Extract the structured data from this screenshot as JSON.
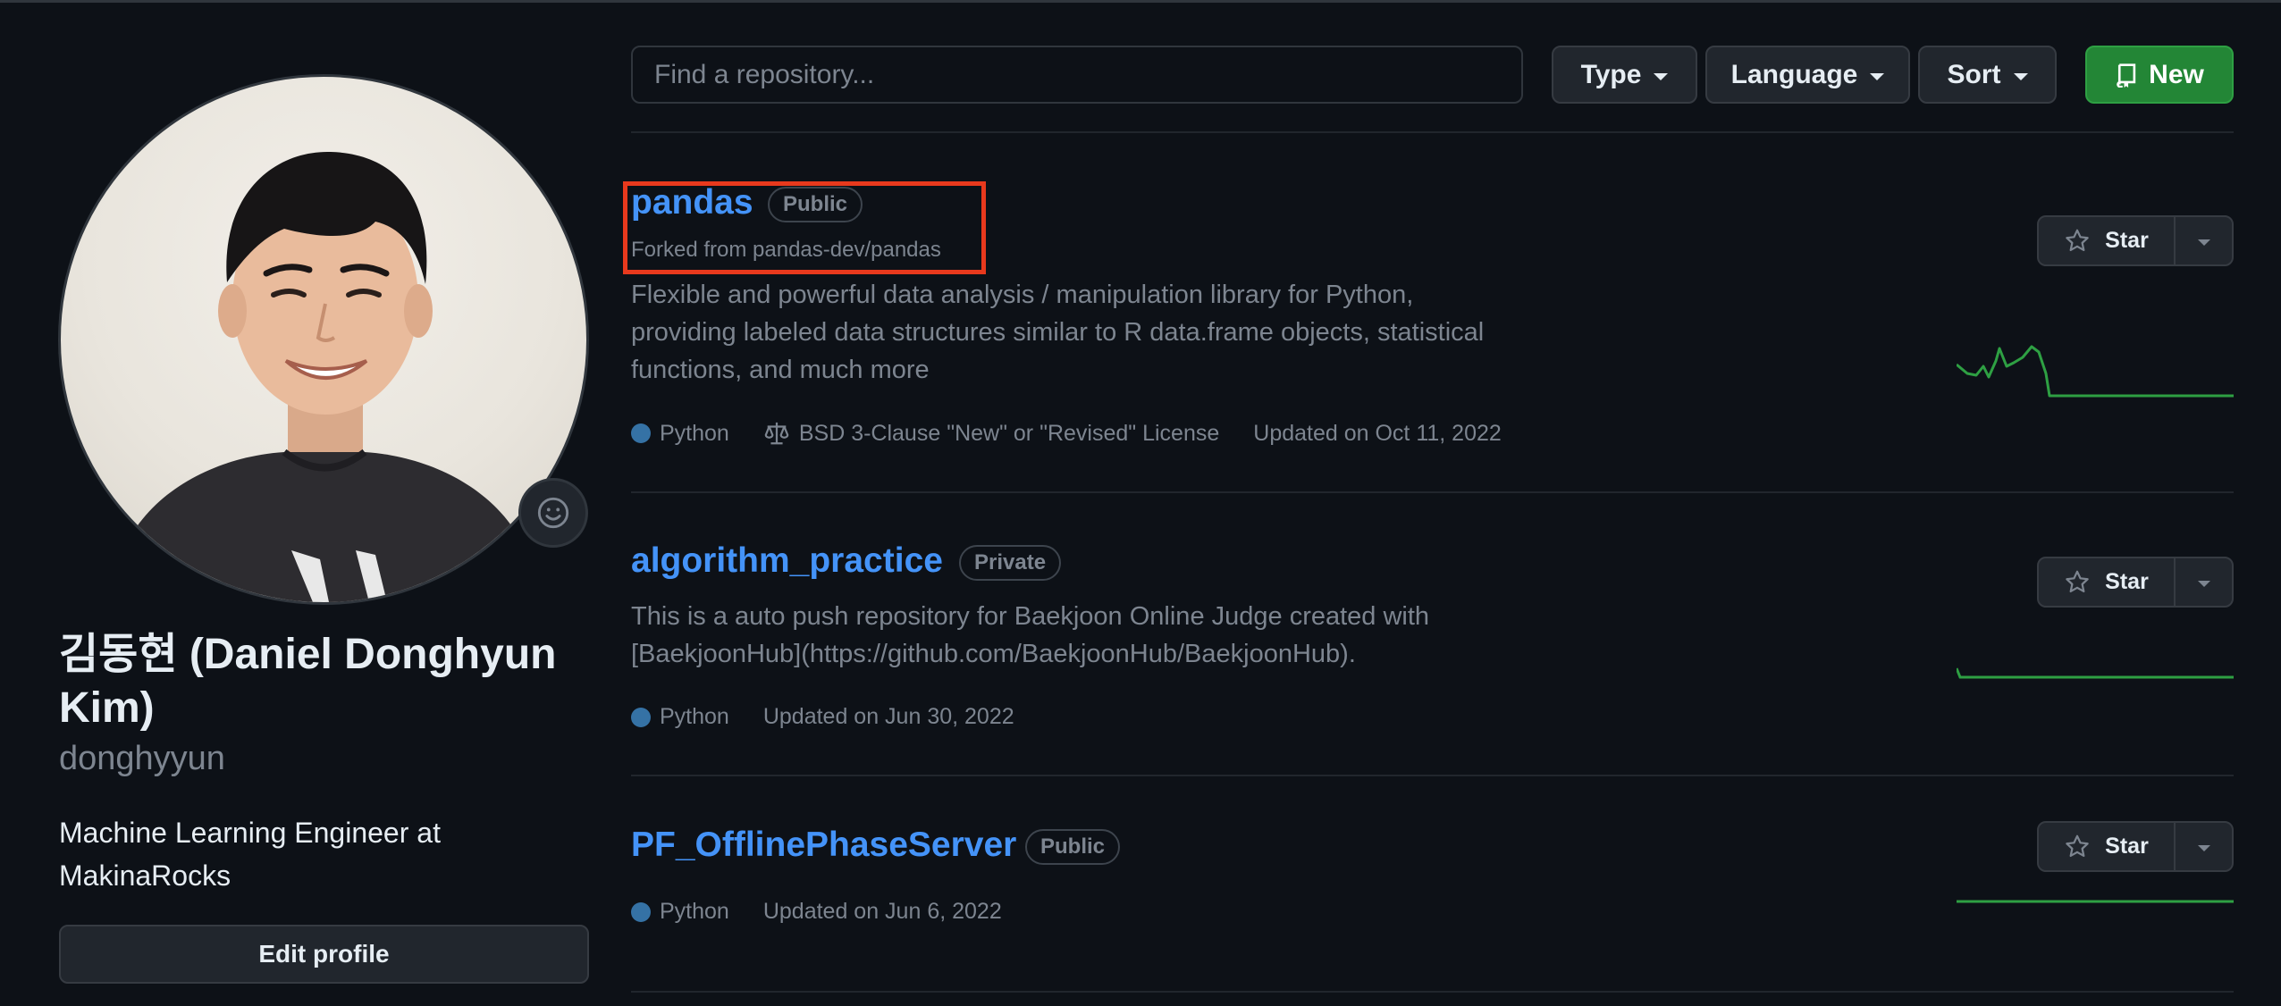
{
  "profile": {
    "name": "김동현 (Daniel Donghyun Kim)",
    "login": "donghyyun",
    "bio": "Machine Learning Engineer at MakinaRocks",
    "edit_label": "Edit profile",
    "status_icon": "smiley-icon"
  },
  "toolbar": {
    "search_placeholder": "Find a repository...",
    "type_label": "Type",
    "language_label": "Language",
    "sort_label": "Sort",
    "new_label": "New"
  },
  "repos": [
    {
      "name": "pandas",
      "visibility": "Public",
      "forked_from": "Forked from pandas-dev/pandas",
      "description": "Flexible and powerful data analysis / manipulation library for Python, providing labeled data structures similar to R data.frame objects, statistical functions, and much more",
      "language": "Python",
      "language_color": "#3572A5",
      "license": "BSD 3-Clause \"New\" or \"Revised\" License",
      "updated": "Updated on Oct 11, 2022",
      "star_label": "Star"
    },
    {
      "name": "algorithm_practice",
      "visibility": "Private",
      "description": "This is a auto push repository for Baekjoon Online Judge created with [BaekjoonHub](https://github.com/BaekjoonHub/BaekjoonHub).",
      "language": "Python",
      "language_color": "#3572A5",
      "updated": "Updated on Jun 30, 2022",
      "star_label": "Star"
    },
    {
      "name": "PF_OfflinePhaseServer",
      "visibility": "Public",
      "language": "Python",
      "language_color": "#3572A5",
      "updated": "Updated on Jun 6, 2022",
      "star_label": "Star"
    }
  ],
  "colors": {
    "link": "#4493f8",
    "accent_green": "#238636",
    "sparkline": "#2ea043",
    "highlight": "#e8391d"
  }
}
